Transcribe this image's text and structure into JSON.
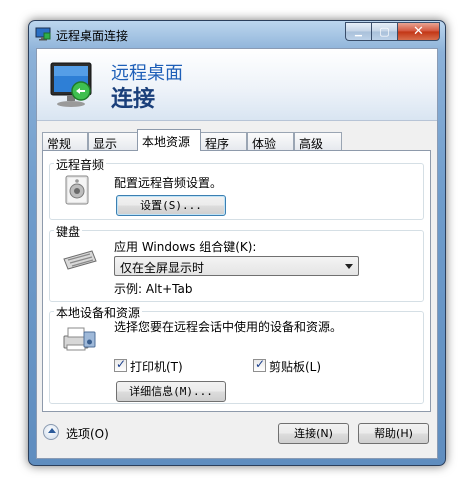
{
  "window": {
    "title": "远程桌面连接",
    "banner_line1": "远程桌面",
    "banner_line2": "连接"
  },
  "caption_buttons": {
    "minimize": "▁",
    "maximize": "▢",
    "close": "✕"
  },
  "tabs": [
    {
      "label": "常规",
      "active": false
    },
    {
      "label": "显示",
      "active": false
    },
    {
      "label": "本地资源",
      "active": true
    },
    {
      "label": "程序",
      "active": false
    },
    {
      "label": "体验",
      "active": false
    },
    {
      "label": "高级",
      "active": false
    }
  ],
  "audio": {
    "group_title": "远程音频",
    "description": "配置远程音频设置。",
    "settings_button": "设置(S)..."
  },
  "keyboard": {
    "group_title": "键盘",
    "label": "应用 Windows 组合键(K):",
    "dropdown_value": "仅在全屏显示时",
    "example": "示例: Alt+Tab"
  },
  "devices": {
    "group_title": "本地设备和资源",
    "description": "选择您要在远程会话中使用的设备和资源。",
    "printer_label": "打印机(T)",
    "printer_checked": true,
    "clipboard_label": "剪贴板(L)",
    "clipboard_checked": true,
    "details_button": "详细信息(M)..."
  },
  "footer": {
    "options_label": "选项(O)",
    "connect_button": "连接(N)",
    "help_button": "帮助(H)"
  },
  "icons": {
    "app": "remote-desktop-app-icon",
    "banner": "remote-desktop-monitor-icon",
    "audio": "speaker-icon",
    "keyboard": "keyboard-icon",
    "devices": "printer-devices-icon",
    "options": "chevron-up-icon"
  },
  "colors": {
    "banner_text": "#1e5fb8",
    "title_bar": "#6f9ccb",
    "close_button": "#c23414"
  }
}
